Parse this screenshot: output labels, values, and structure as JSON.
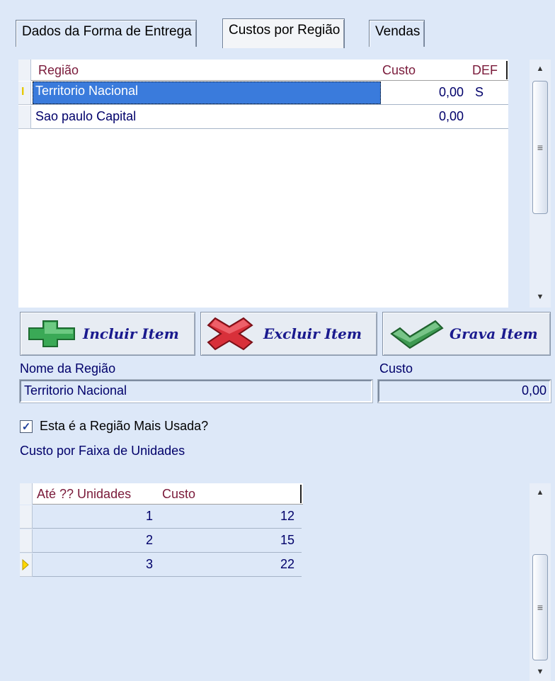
{
  "tabs": [
    {
      "label": "Dados da Forma de Entrega",
      "active": false
    },
    {
      "label": "Custos por Região",
      "active": true
    },
    {
      "label": "Vendas",
      "active": false
    }
  ],
  "region_grid": {
    "columns": [
      "Região",
      "Custo",
      "DEF"
    ],
    "rows": [
      {
        "regiao": "Territorio Nacional",
        "custo": "0,00",
        "def": "S",
        "selected": true
      },
      {
        "regiao": "Sao paulo Capital",
        "custo": "0,00",
        "def": "",
        "selected": false
      }
    ]
  },
  "buttons": {
    "include": "Incluir Item",
    "exclude": "Excluir Item",
    "save": "Grava Item"
  },
  "form": {
    "name_label": "Nome da Região",
    "name_value": "Territorio Nacional",
    "cost_label": "Custo",
    "cost_value": "0,00",
    "most_used_label": "Esta é a Região Mais Usada?",
    "most_used_checked": true,
    "range_section_label": "Custo por Faixa de Unidades"
  },
  "range_grid": {
    "columns": [
      "Até ?? Unidades",
      "Custo"
    ],
    "rows": [
      {
        "units": "1",
        "custo": "12"
      },
      {
        "units": "2",
        "custo": "15"
      },
      {
        "units": "3",
        "custo": "22",
        "current": true
      }
    ]
  },
  "icons": {
    "plus": "plus-icon",
    "cross": "cross-icon",
    "check": "check-icon"
  },
  "colors": {
    "background": "#dde8f8",
    "selection": "#3a7bdc",
    "header_text": "#7a1a3a",
    "text": "#00006a",
    "button_text": "#1a1a8e"
  }
}
